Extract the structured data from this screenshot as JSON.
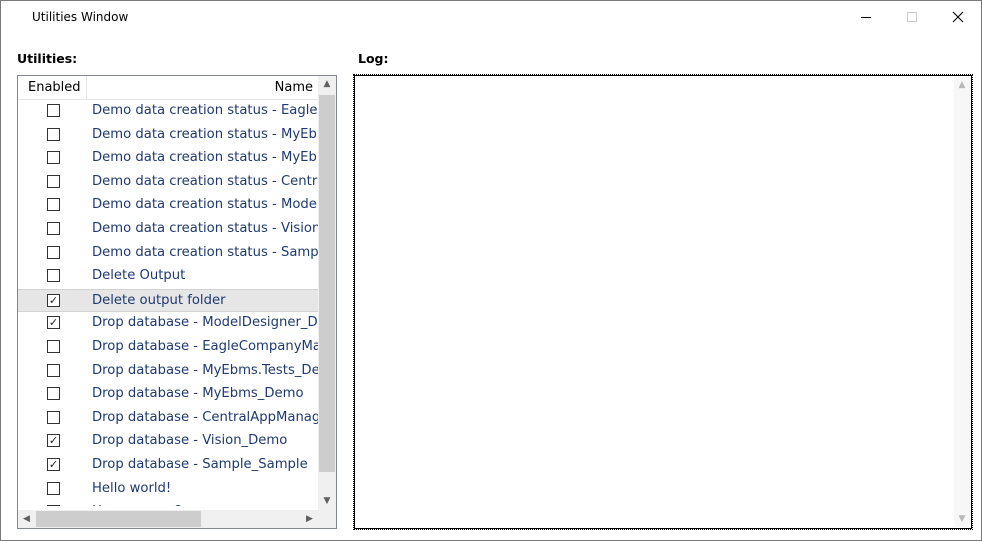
{
  "window": {
    "title": "Utilities Window",
    "close_glyph": "✕"
  },
  "utilities": {
    "label": "Utilities:",
    "columns": {
      "enabled": "Enabled",
      "name": "Name"
    },
    "items": [
      {
        "name": "Demo data creation status - Eagle",
        "enabled": false
      },
      {
        "name": "Demo data creation status - MyEbms",
        "enabled": false
      },
      {
        "name": "Demo data creation status - MyEbms",
        "enabled": false
      },
      {
        "name": "Demo data creation status - CentralA",
        "enabled": false
      },
      {
        "name": "Demo data creation status - ModelD",
        "enabled": false
      },
      {
        "name": "Demo data creation status - Vision",
        "enabled": false
      },
      {
        "name": "Demo data creation status - Sample",
        "enabled": false
      },
      {
        "name": "Delete Output",
        "enabled": false
      },
      {
        "name": "Delete output folder",
        "enabled": true,
        "selected": true
      },
      {
        "name": "Drop database - ModelDesigner_Der",
        "enabled": true
      },
      {
        "name": "Drop database - EagleCompanyMana",
        "enabled": false
      },
      {
        "name": "Drop database - MyEbms.Tests_Demo",
        "enabled": false
      },
      {
        "name": "Drop database - MyEbms_Demo",
        "enabled": false
      },
      {
        "name": "Drop database - CentralAppManager",
        "enabled": false
      },
      {
        "name": "Drop database - Vision_Demo",
        "enabled": true
      },
      {
        "name": "Drop database - Sample_Sample",
        "enabled": true
      },
      {
        "name": "Hello world!",
        "enabled": false
      },
      {
        "name": "How are you?",
        "enabled": false
      }
    ]
  },
  "log": {
    "label": "Log:",
    "content": ""
  },
  "icons": {
    "check": "✓",
    "arrow_up": "▲",
    "arrow_down": "▼",
    "arrow_left": "◀",
    "arrow_right": "▶"
  }
}
